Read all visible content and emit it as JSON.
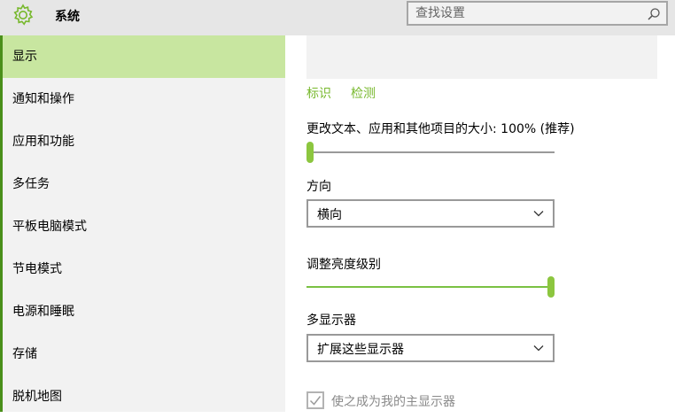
{
  "header": {
    "title": "系统",
    "search_placeholder": "查找设置"
  },
  "sidebar": {
    "items": [
      {
        "label": "显示",
        "active": true
      },
      {
        "label": "通知和操作"
      },
      {
        "label": "应用和功能"
      },
      {
        "label": "多任务"
      },
      {
        "label": "平板电脑模式"
      },
      {
        "label": "节电模式"
      },
      {
        "label": "电源和睡眠"
      },
      {
        "label": "存储"
      },
      {
        "label": "脱机地图"
      }
    ]
  },
  "main": {
    "identify_link": "标识",
    "detect_link": "检测",
    "scale_label": "更改文本、应用和其他项目的大小: 100% (推荐)",
    "scale_slider_fraction": 0.0,
    "orientation_label": "方向",
    "orientation_value": "横向",
    "brightness_label": "调整亮度级别",
    "brightness_slider_fraction": 1.0,
    "multi_display_label": "多显示器",
    "multi_display_value": "扩展这些显示器",
    "main_display_checkbox_label": "使之成为我的主显示器",
    "main_display_checked": true
  },
  "colors": {
    "accent": "#8cc63f",
    "link": "#77b82c",
    "active_item_bg": "#c8e6a0"
  },
  "icons": [
    "gear-icon",
    "search-icon",
    "chevron-down-icon",
    "checkmark-icon"
  ]
}
